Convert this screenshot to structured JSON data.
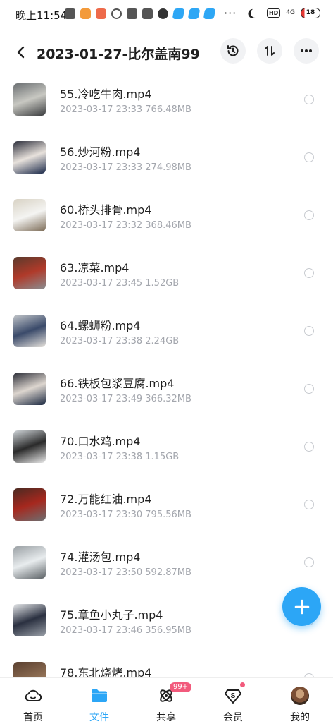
{
  "status_bar": {
    "time": "晚上11:54",
    "more": "···",
    "network": "4G",
    "battery": "18"
  },
  "header": {
    "title": "2023-01-27-比尔盖南99..."
  },
  "files": [
    {
      "name": "55.冷吃牛肉.mp4",
      "meta": "2023-03-17  23:33  766.48MB",
      "thumb_colors": [
        "#6b6f72",
        "#c8c8c2",
        "#3a3c3e"
      ]
    },
    {
      "name": "56.炒河粉.mp4",
      "meta": "2023-03-17  23:33  274.98MB",
      "thumb_colors": [
        "#2d2f3c",
        "#e8e2dc",
        "#1c2a4a"
      ]
    },
    {
      "name": "60.桥头排骨.mp4",
      "meta": "2023-03-17  23:32  368.46MB",
      "thumb_colors": [
        "#d8d2c4",
        "#f4f4f2",
        "#7b6a55"
      ]
    },
    {
      "name": "63.凉菜.mp4",
      "meta": "2023-03-17  23:45  1.52GB",
      "thumb_colors": [
        "#5a3a2c",
        "#b03a2a",
        "#8a8d90"
      ]
    },
    {
      "name": "64.螺蛳粉.mp4",
      "meta": "2023-03-17  23:38  2.24GB",
      "thumb_colors": [
        "#c2c6ca",
        "#3a4a6a",
        "#e6e2dc"
      ]
    },
    {
      "name": "66.铁板包浆豆腐.mp4",
      "meta": "2023-03-17  23:49  366.32MB",
      "thumb_colors": [
        "#2a2c36",
        "#ddd6cf",
        "#1b2840"
      ]
    },
    {
      "name": "70.口水鸡.mp4",
      "meta": "2023-03-17  23:38  1.15GB",
      "thumb_colors": [
        "#cfd4d8",
        "#2a2a2a",
        "#e8e8e8"
      ]
    },
    {
      "name": "72.万能红油.mp4",
      "meta": "2023-03-17  23:30  795.56MB",
      "thumb_colors": [
        "#4a2a22",
        "#a6281e",
        "#6e6e70"
      ]
    },
    {
      "name": "74.灌汤包.mp4",
      "meta": "2023-03-17  23:50  592.87MB",
      "thumb_colors": [
        "#9aa0a4",
        "#e8ecee",
        "#5c6266"
      ]
    },
    {
      "name": "75.章鱼小丸子.mp4",
      "meta": "2023-03-17  23:46  356.95MB",
      "thumb_colors": [
        "#e6e8ea",
        "#2a3040",
        "#9aa0a8"
      ]
    },
    {
      "name": "78.东北烧烤.mp4",
      "meta": "",
      "thumb_colors": [
        "#5a4030",
        "#8a6a50",
        "#c0a080"
      ]
    }
  ],
  "nav": {
    "home": "首页",
    "files": "文件",
    "share": "共享",
    "share_badge": "99+",
    "vip": "会员",
    "me": "我的"
  },
  "colors": {
    "accent": "#2ca6f6",
    "badge": "#f25a7c",
    "meta_text": "#a3a6ad"
  }
}
